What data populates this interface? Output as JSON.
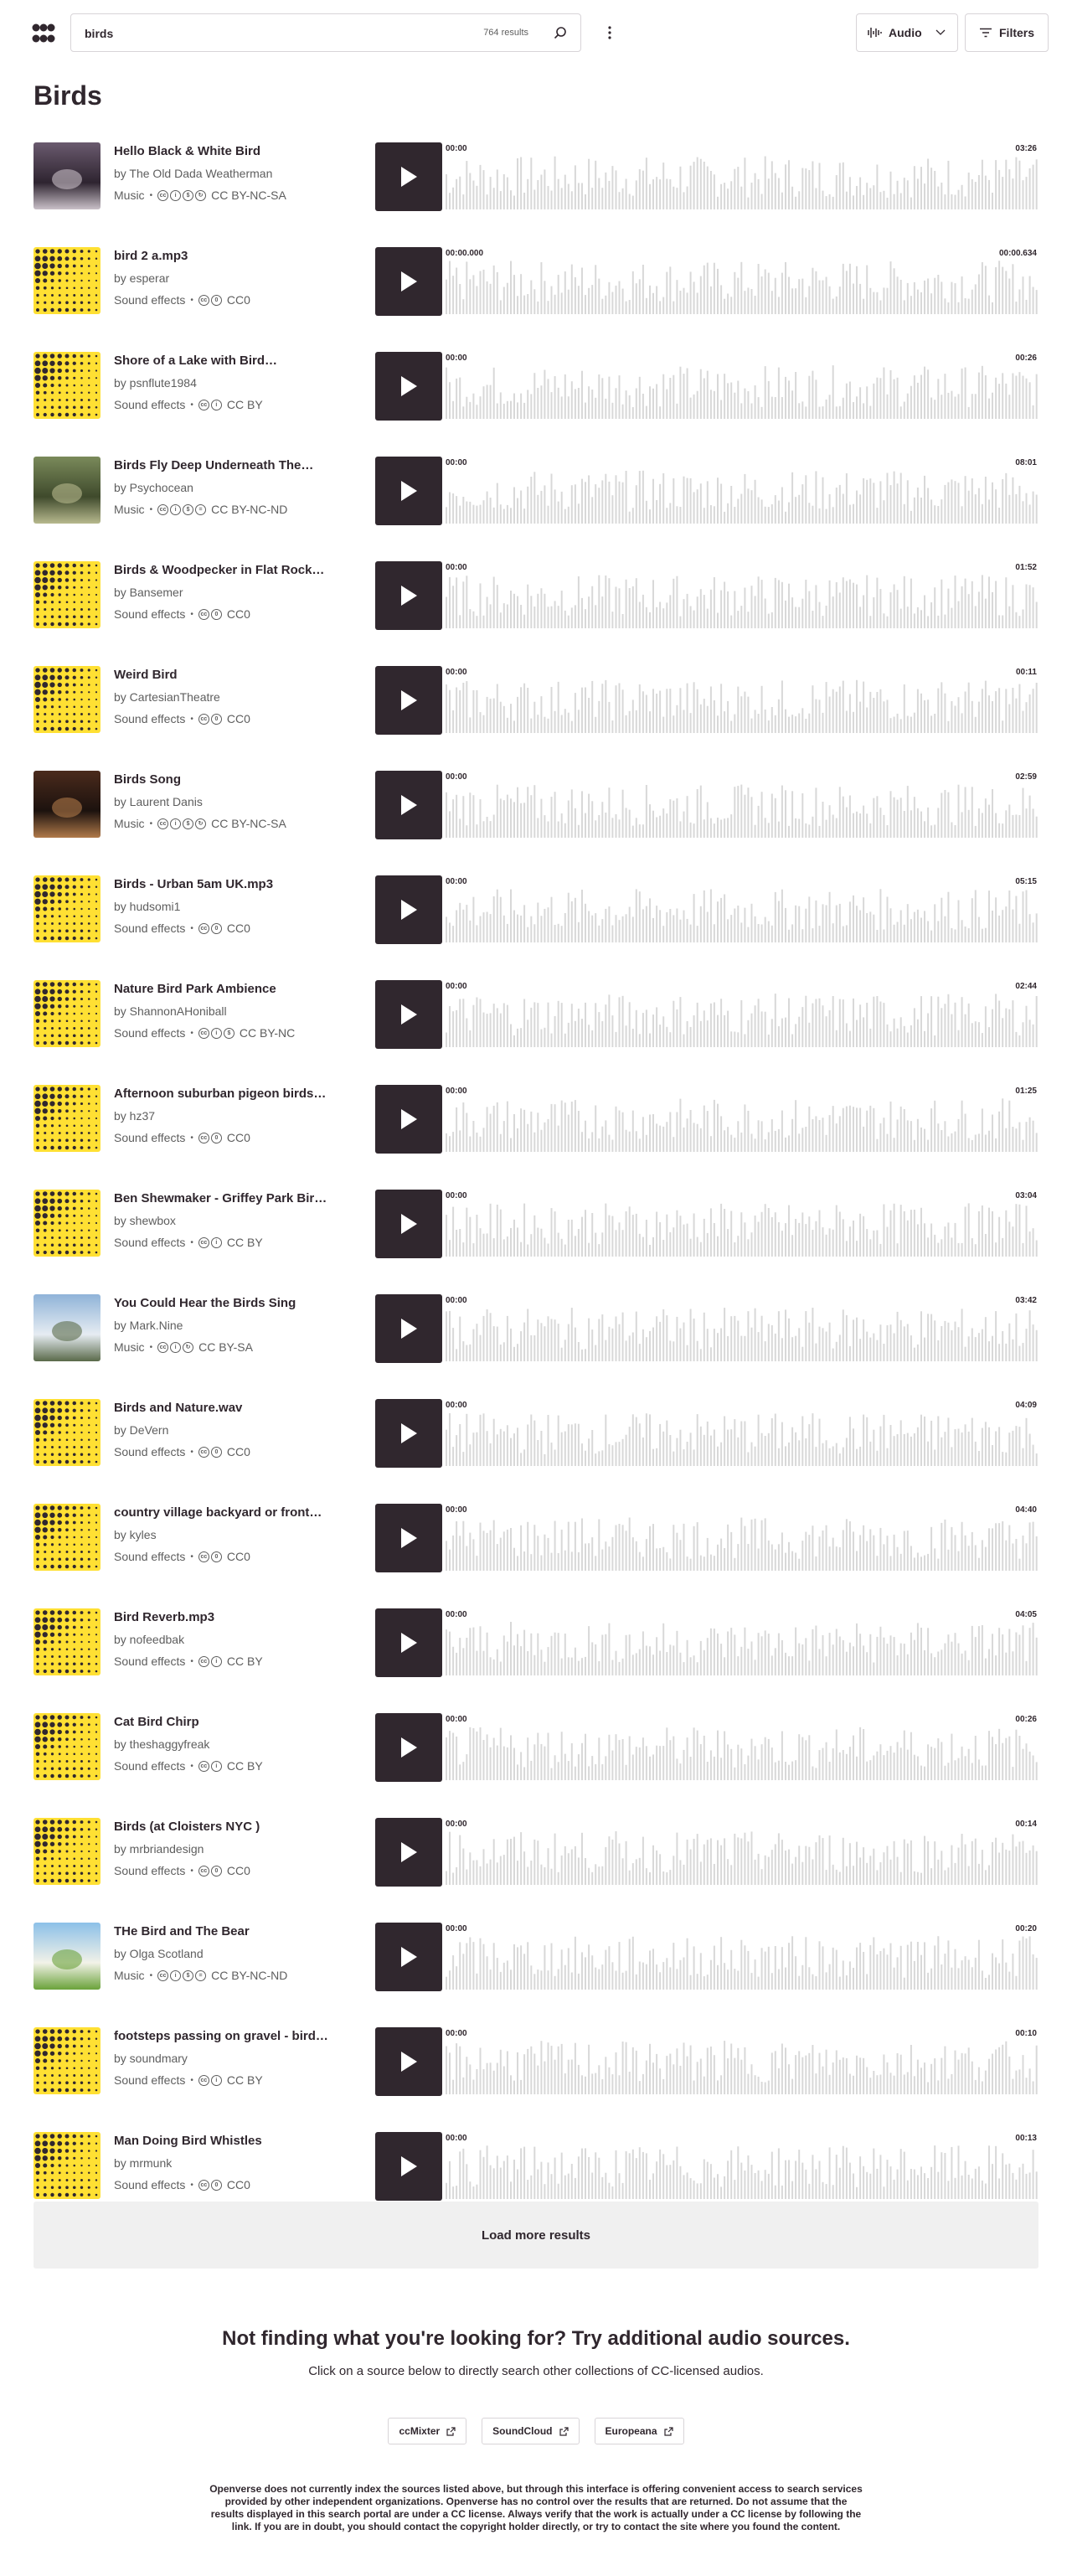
{
  "header": {
    "search_value": "birds",
    "results_count": "764 results",
    "media_type_label": "Audio",
    "filters_label": "Filters"
  },
  "page_title": "Birds",
  "results": [
    {
      "title": "Hello Black & White Bird",
      "creator": "by The Old Dada Weatherman",
      "category": "Music",
      "license": "CC BY-NC-SA",
      "license_icons": [
        "cc",
        "by",
        "nc",
        "sa"
      ],
      "thumb": "photo-dark",
      "start": "00:00",
      "end": "03:26"
    },
    {
      "title": "bird 2 a.mp3",
      "creator": "by esperar",
      "category": "Sound effects",
      "license": "CC0",
      "license_icons": [
        "cc",
        "zero"
      ],
      "thumb": "dots",
      "start": "00:00.000",
      "end": "00:00.634"
    },
    {
      "title": "Shore of a Lake with Bird…",
      "creator": "by psnflute1984",
      "category": "Sound effects",
      "license": "CC BY",
      "license_icons": [
        "cc",
        "by"
      ],
      "thumb": "dots",
      "start": "00:00",
      "end": "00:26"
    },
    {
      "title": "Birds Fly Deep Underneath The…",
      "creator": "by Psychocean",
      "category": "Music",
      "license": "CC BY-NC-ND",
      "license_icons": [
        "cc",
        "by",
        "nc",
        "nd"
      ],
      "thumb": "photo-green",
      "start": "00:00",
      "end": "08:01"
    },
    {
      "title": "Birds & Woodpecker in Flat Rock…",
      "creator": "by Bansemer",
      "category": "Sound effects",
      "license": "CC0",
      "license_icons": [
        "cc",
        "zero"
      ],
      "thumb": "dots",
      "start": "00:00",
      "end": "01:52"
    },
    {
      "title": "Weird Bird",
      "creator": "by CartesianTheatre",
      "category": "Sound effects",
      "license": "CC0",
      "license_icons": [
        "cc",
        "zero"
      ],
      "thumb": "dots",
      "start": "00:00",
      "end": "00:11"
    },
    {
      "title": "Birds Song",
      "creator": "by Laurent Danis",
      "category": "Music",
      "license": "CC BY-NC-SA",
      "license_icons": [
        "cc",
        "by",
        "nc",
        "sa"
      ],
      "thumb": "photo-brown",
      "start": "00:00",
      "end": "02:59"
    },
    {
      "title": "Birds - Urban 5am UK.mp3",
      "creator": "by hudsomi1",
      "category": "Sound effects",
      "license": "CC0",
      "license_icons": [
        "cc",
        "zero"
      ],
      "thumb": "dots",
      "start": "00:00",
      "end": "05:15"
    },
    {
      "title": "Nature Bird Park Ambience",
      "creator": "by ShannonAHoniball",
      "category": "Sound effects",
      "license": "CC BY-NC",
      "license_icons": [
        "cc",
        "by",
        "nc"
      ],
      "thumb": "dots",
      "start": "00:00",
      "end": "02:44"
    },
    {
      "title": "Afternoon suburban pigeon birds…",
      "creator": "by hz37",
      "category": "Sound effects",
      "license": "CC0",
      "license_icons": [
        "cc",
        "zero"
      ],
      "thumb": "dots",
      "start": "00:00",
      "end": "01:25"
    },
    {
      "title": "Ben Shewmaker - Griffey Park Bir…",
      "creator": "by shewbox",
      "category": "Sound effects",
      "license": "CC BY",
      "license_icons": [
        "cc",
        "by"
      ],
      "thumb": "dots",
      "start": "00:00",
      "end": "03:04"
    },
    {
      "title": "You Could Hear the Birds Sing",
      "creator": "by Mark.Nine",
      "category": "Music",
      "license": "CC BY-SA",
      "license_icons": [
        "cc",
        "by",
        "sa"
      ],
      "thumb": "photo-sky",
      "start": "00:00",
      "end": "03:42"
    },
    {
      "title": "Birds and Nature.wav",
      "creator": "by DeVern",
      "category": "Sound effects",
      "license": "CC0",
      "license_icons": [
        "cc",
        "zero"
      ],
      "thumb": "dots",
      "start": "00:00",
      "end": "04:09"
    },
    {
      "title": "country village backyard or front…",
      "creator": "by kyles",
      "category": "Sound effects",
      "license": "CC0",
      "license_icons": [
        "cc",
        "zero"
      ],
      "thumb": "dots",
      "start": "00:00",
      "end": "04:40"
    },
    {
      "title": "Bird Reverb.mp3",
      "creator": "by nofeedbak",
      "category": "Sound effects",
      "license": "CC BY",
      "license_icons": [
        "cc",
        "by"
      ],
      "thumb": "dots",
      "start": "00:00",
      "end": "04:05"
    },
    {
      "title": "Cat Bird Chirp",
      "creator": "by theshaggyfreak",
      "category": "Sound effects",
      "license": "CC BY",
      "license_icons": [
        "cc",
        "by"
      ],
      "thumb": "dots",
      "start": "00:00",
      "end": "00:26"
    },
    {
      "title": "Birds (at Cloisters NYC )",
      "creator": "by mrbriandesign",
      "category": "Sound effects",
      "license": "CC0",
      "license_icons": [
        "cc",
        "zero"
      ],
      "thumb": "dots",
      "start": "00:00",
      "end": "00:14"
    },
    {
      "title": "THe Bird and The Bear",
      "creator": "by Olga Scotland",
      "category": "Music",
      "license": "CC BY-NC-ND",
      "license_icons": [
        "cc",
        "by",
        "nc",
        "nd"
      ],
      "thumb": "photo-meadow",
      "start": "00:00",
      "end": "00:20"
    },
    {
      "title": "footsteps passing on gravel - bird…",
      "creator": "by soundmary",
      "category": "Sound effects",
      "license": "CC BY",
      "license_icons": [
        "cc",
        "by"
      ],
      "thumb": "dots",
      "start": "00:00",
      "end": "00:10"
    },
    {
      "title": "Man Doing Bird Whistles",
      "creator": "by mrmunk",
      "category": "Sound effects",
      "license": "CC0",
      "license_icons": [
        "cc",
        "zero"
      ],
      "thumb": "dots",
      "start": "00:00",
      "end": "00:13"
    }
  ],
  "load_more_label": "Load more results",
  "extra_sources": {
    "heading": "Not finding what you're looking for? Try additional audio sources.",
    "subheading": "Click on a source below to directly search other collections of CC-licensed audios.",
    "sources": [
      "ccMixter",
      "SoundCloud",
      "Europeana"
    ]
  },
  "disclaimer": "Openverse does not currently index the sources listed above, but through this interface is offering convenient access to search services provided by other independent organizations. Openverse has no control over the results that are returned. Do not assume that the results displayed in this search portal are under a CC license. Always verify that the work is actually under a CC license by following the link. If you are in doubt, you should contact the copyright holder directly, or try to contact the site where you found the content.",
  "colors": {
    "accent_yellow": "#ffe033",
    "dark": "#30272e",
    "wave_gray": "#d8d8d8"
  }
}
